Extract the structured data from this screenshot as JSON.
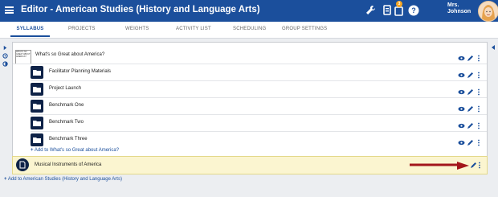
{
  "app": {
    "title": "Editor - American Studies (History and Language Arts)",
    "user_line1": "Mrs.",
    "user_line2": "Johnson",
    "notification_count": "3"
  },
  "tabs": [
    {
      "label": "SYLLABUS",
      "active": true
    },
    {
      "label": "PROJECTS",
      "active": false
    },
    {
      "label": "WEIGHTS",
      "active": false
    },
    {
      "label": "ACTIVITY LIST",
      "active": false
    },
    {
      "label": "SCHEDULING",
      "active": false
    },
    {
      "label": "GROUP SETTINGS",
      "active": false
    }
  ],
  "unit": {
    "title": "What's so Great about America?",
    "thumbnail_text": "WHAT'S SO GREAT ABOUT AMERICA?",
    "items": [
      {
        "label": "Facilitator Planning Materials"
      },
      {
        "label": "Project Launch"
      },
      {
        "label": "Benchmark One"
      },
      {
        "label": "Benchmark Two"
      },
      {
        "label": "Benchmark Three"
      }
    ],
    "add_link": "Add to What's so Great about America?"
  },
  "highlighted_item": {
    "label": "Musical Instruments of America"
  },
  "course_add_link": "Add to American Studies (History and Language Arts)",
  "colors": {
    "topbar": "#1b4f9c",
    "folder": "#0e2247",
    "highlight": "#fbf5d0",
    "arrow": "#a3161b",
    "link": "#1b4f9c"
  },
  "icons": [
    "menu-icon",
    "wrench-icon",
    "copy-icon",
    "clipboard-icon",
    "help-icon",
    "eye-icon",
    "pencil-icon",
    "more-vert-icon",
    "folder-icon",
    "document-icon",
    "plus-icon"
  ]
}
